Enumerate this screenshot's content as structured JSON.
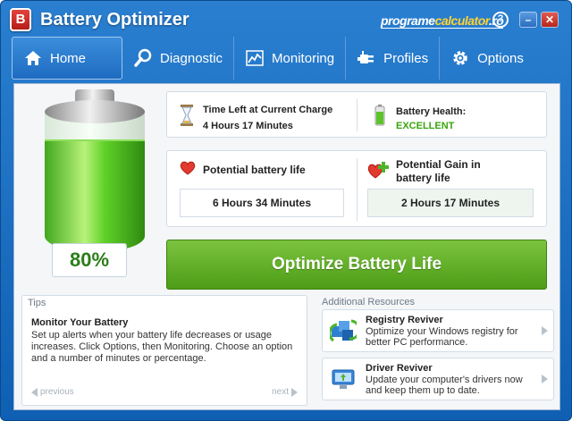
{
  "window": {
    "title": "Battery Optimizer",
    "logo_letter": "B",
    "watermark_prefix": "programe",
    "watermark_mid": "calculator",
    "watermark_suffix": ".ro",
    "help_label": "?",
    "minimize_label": "–",
    "close_label": "✕"
  },
  "nav": {
    "items": [
      {
        "label": "Home",
        "icon": "home-icon"
      },
      {
        "label": "Diagnostic",
        "icon": "magnifier-icon"
      },
      {
        "label": "Monitoring",
        "icon": "chart-icon"
      },
      {
        "label": "Profiles",
        "icon": "plug-icon"
      },
      {
        "label": "Options",
        "icon": "gear-icon"
      }
    ],
    "active": "Home"
  },
  "battery": {
    "charge_percent": 80,
    "percent_label": "80%"
  },
  "status": {
    "time_left_label": "Time Left at Current Charge",
    "time_left_value": "4 Hours 17 Minutes",
    "health_label": "Battery Health:",
    "health_value": "EXCELLENT"
  },
  "life": {
    "potential_label": "Potential battery life",
    "potential_value": "6 Hours 34 Minutes",
    "gain_label": "Potential Gain in battery life",
    "gain_value": "2 Hours 17 Minutes"
  },
  "optimize_button": "Optimize Battery Life",
  "tips": {
    "section_title": "Tips",
    "headline": "Monitor Your Battery",
    "body": "Set up alerts when your battery life decreases or usage increases. Click Options, then Monitoring. Choose an option and a number of minutes or percentage.",
    "previous": "previous",
    "next": "next"
  },
  "resources": {
    "section_title": "Additional Resources",
    "items": [
      {
        "title": "Registry Reviver",
        "desc": "Optimize your Windows registry for better PC performance."
      },
      {
        "title": "Driver Reviver",
        "desc": "Update your computer's drivers now and keep them up to date."
      }
    ]
  },
  "colors": {
    "accent_blue": "#1e6cc1",
    "optimize_green": "#5ca822",
    "health_green": "#39a40f",
    "percent_green": "#2c7d1a"
  }
}
